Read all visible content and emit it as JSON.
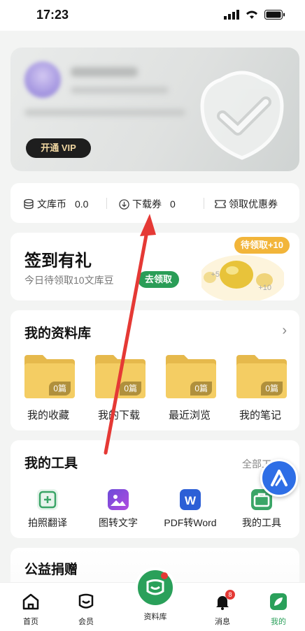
{
  "status_bar": {
    "time": "17:23"
  },
  "vip_card": {
    "button_label": "开通 VIP"
  },
  "stats": {
    "coins_label": "文库币",
    "coins_value": "0.0",
    "coupons_label": "下载券",
    "coupons_value": "0",
    "discount_label": "领取优惠券"
  },
  "signin": {
    "title": "签到有礼",
    "subtitle": "今日待领取10文库豆",
    "action_label": "去领取",
    "badge": "待领取+10",
    "plus5": "+5",
    "plus10": "+10"
  },
  "library": {
    "title": "我的资料库",
    "folders": [
      {
        "label": "我的收藏",
        "count": "0篇"
      },
      {
        "label": "我的下载",
        "count": "0篇"
      },
      {
        "label": "最近浏览",
        "count": "0篇"
      },
      {
        "label": "我的笔记",
        "count": "0篇"
      }
    ]
  },
  "tools": {
    "title": "我的工具",
    "more_label": "全部工",
    "items": [
      {
        "label": "拍照翻译",
        "icon": "camera-translate-icon"
      },
      {
        "label": "图转文字",
        "icon": "image-to-text-icon"
      },
      {
        "label": "PDF转Word",
        "icon": "pdf-to-word-icon"
      },
      {
        "label": "我的工具",
        "icon": "toolbox-icon"
      }
    ]
  },
  "charity": {
    "title": "公益捐赠"
  },
  "tabbar": {
    "home": "首页",
    "member": "会员",
    "library": "资料库",
    "messages": "消息",
    "messages_badge": "8",
    "mine": "我的"
  },
  "colors": {
    "accent": "#2aa05a",
    "vip_gold": "#f0d7a2",
    "annotation_arrow": "#e53935",
    "badge_orange": "#f2b53a"
  }
}
